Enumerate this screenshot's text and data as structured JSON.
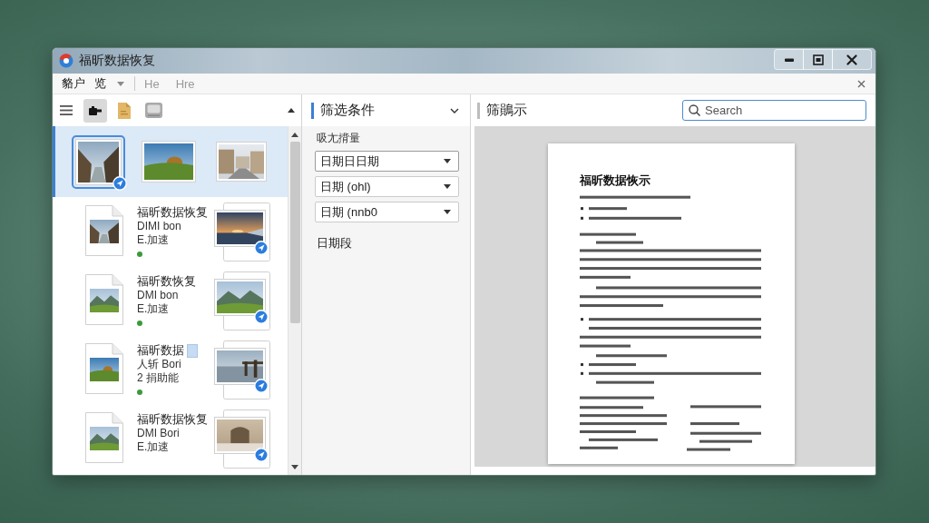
{
  "window": {
    "title": "福昕数据恢复"
  },
  "menu_bar": {
    "items": [
      {
        "label": "貉户",
        "kind": "plain",
        "disabled": false
      },
      {
        "label": "览",
        "kind": "dropdown",
        "disabled": false
      },
      {
        "label": "He",
        "kind": "plain",
        "disabled": true
      },
      {
        "label": "Hre",
        "kind": "plain",
        "disabled": true
      }
    ]
  },
  "toolbar": {
    "tools": [
      {
        "kind": "menu",
        "selected": false
      },
      {
        "kind": "camera",
        "selected": true
      },
      {
        "kind": "document",
        "selected": false
      },
      {
        "kind": "drive",
        "selected": false
      }
    ]
  },
  "file_list": {
    "rows": [
      {
        "kind": "gallery",
        "selected": true,
        "thumbnails": [
          {
            "selected": true,
            "badge": true
          },
          {
            "selected": false,
            "badge": false
          },
          {
            "selected": false,
            "badge": false
          }
        ]
      },
      {
        "kind": "file",
        "selected": false,
        "name": "福昕数据恢复",
        "details": [
          "DIMI bon",
          "E.加速"
        ],
        "highlight": false,
        "dot": true,
        "badge": true
      },
      {
        "kind": "file",
        "selected": false,
        "name": "福昕数恢复",
        "details": [
          "DMI bon",
          "E.加速"
        ],
        "highlight": false,
        "dot": true,
        "badge": true
      },
      {
        "kind": "file",
        "selected": false,
        "name": "福昕数据",
        "details": [
          "人斩 Bori",
          "2 捐助能"
        ],
        "highlight": true,
        "dot": true,
        "badge": true
      },
      {
        "kind": "file",
        "selected": false,
        "name": "福昕数据恢复",
        "details": [
          "DMI Bori",
          "E.加速"
        ],
        "highlight": false,
        "dot": false,
        "badge": true
      }
    ]
  },
  "filter_panel": {
    "title": "筛选条件",
    "label": "吸尢揹量",
    "dropdowns": [
      {
        "value": "日期日日期"
      },
      {
        "value": "日期 (ohl)"
      },
      {
        "value": "日期 (nnb0"
      }
    ],
    "range_label": "日期段"
  },
  "preview_panel": {
    "title": "筛鶰示",
    "search": {
      "placeholder": "Search"
    },
    "document": {
      "title": "福昕数据恢示"
    }
  }
}
